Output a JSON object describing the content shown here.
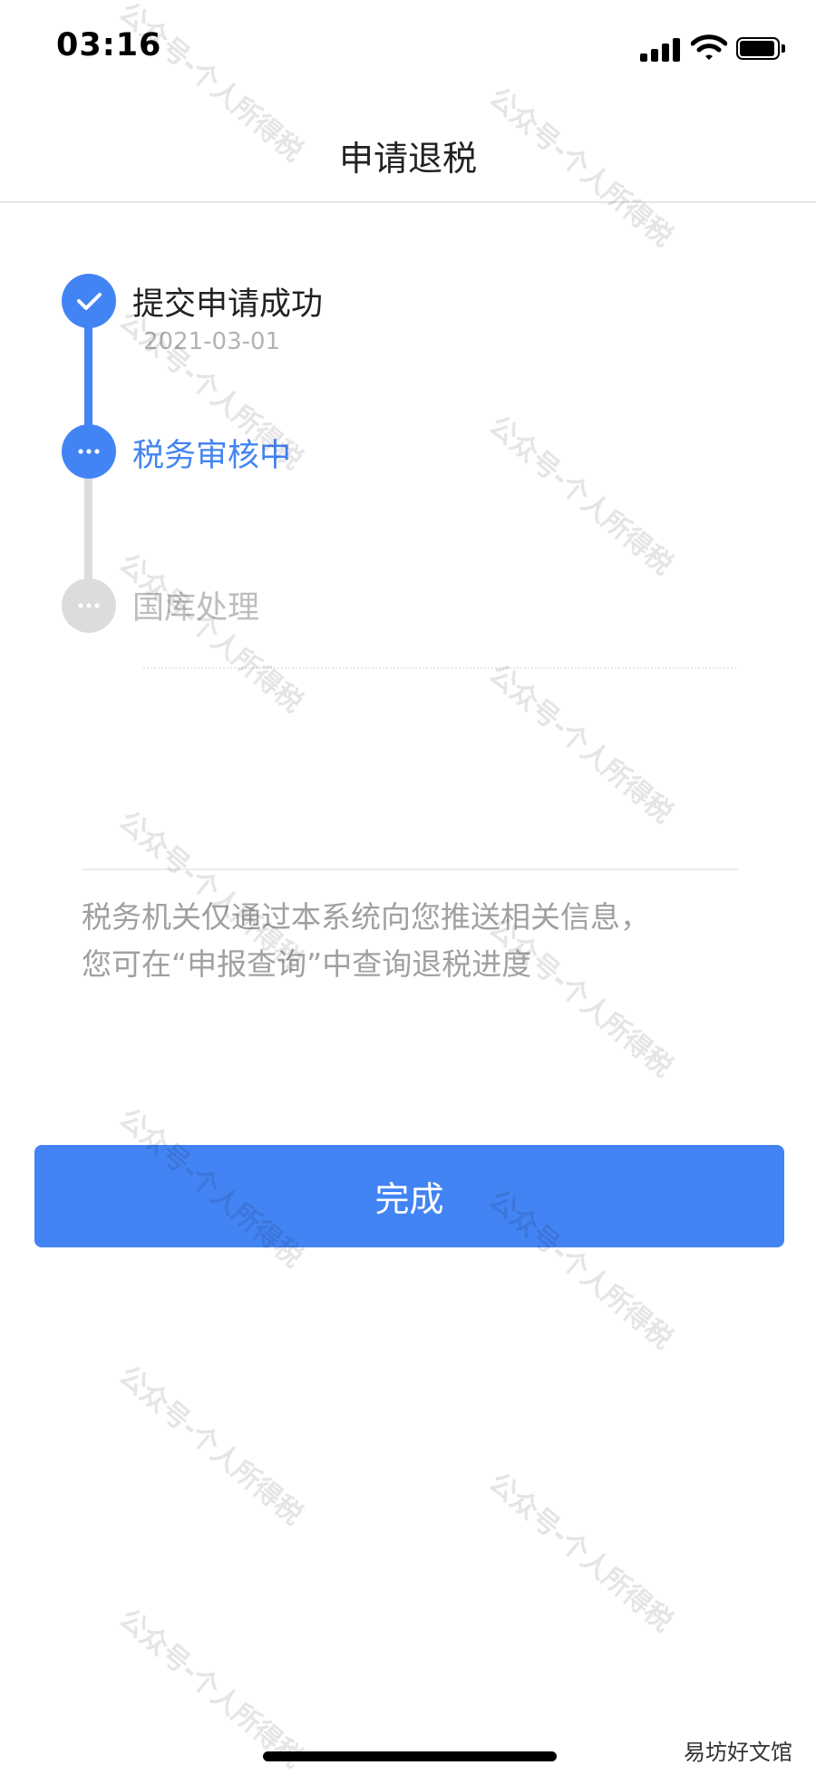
{
  "status_bar": {
    "time": "03:16"
  },
  "nav": {
    "title": "申请退税"
  },
  "timeline": {
    "steps": [
      {
        "label": "提交申请成功",
        "date": "2021-03-01",
        "state": "done",
        "icon": "check-icon",
        "color": "#4384f4"
      },
      {
        "label": "税务审核中",
        "state": "in-progress",
        "icon": "ellipsis-icon",
        "color": "#4384f4"
      },
      {
        "label": "国库处理",
        "state": "pending",
        "icon": "ellipsis-icon",
        "color": "#bdbdbd"
      }
    ]
  },
  "notice": {
    "line1": "税务机关仅通过本系统向您推送相关信息，",
    "line2": "您可在“申报查询”中查询退税进度"
  },
  "actions": {
    "done_label": "完成"
  },
  "watermark": {
    "text": "公众号-个人所得税"
  },
  "corner_mark": "易坊好文馆",
  "colors": {
    "accent": "#4384f4",
    "pending": "#dcdcdc",
    "muted_text": "#a0a0a0"
  }
}
